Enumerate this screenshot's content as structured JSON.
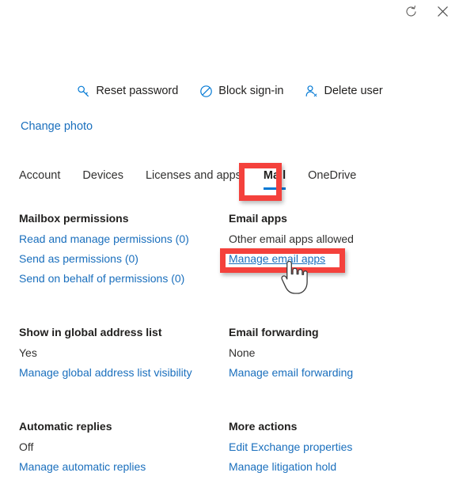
{
  "window": {
    "refresh_label": "Refresh",
    "close_label": "Close"
  },
  "command_bar": {
    "items": [
      {
        "label": "Reset password",
        "icon": "key-icon"
      },
      {
        "label": "Block sign-in",
        "icon": "block-circle-slash-icon"
      },
      {
        "label": "Delete user",
        "icon": "person-remove-icon"
      }
    ]
  },
  "change_photo": {
    "label": "Change photo"
  },
  "tabs": [
    {
      "label": "Account",
      "selected": false
    },
    {
      "label": "Devices",
      "selected": false
    },
    {
      "label": "Licenses and apps",
      "selected": false
    },
    {
      "label": "Mail",
      "selected": true
    },
    {
      "label": "OneDrive",
      "selected": false
    }
  ],
  "sections": {
    "mailbox_permissions": {
      "title": "Mailbox permissions",
      "links": [
        "Read and manage permissions (0)",
        "Send as permissions (0)",
        "Send on behalf of permissions (0)"
      ]
    },
    "email_apps": {
      "title": "Email apps",
      "value": "Other email apps allowed",
      "link": "Manage email apps"
    },
    "global_address_list": {
      "title": "Show in global address list",
      "value": "Yes",
      "link": "Manage global address list visibility"
    },
    "email_forwarding": {
      "title": "Email forwarding",
      "value": "None",
      "link": "Manage email forwarding"
    },
    "automatic_replies": {
      "title": "Automatic replies",
      "value": "Off",
      "link": "Manage automatic replies"
    },
    "more_actions": {
      "title": "More actions",
      "links": [
        "Edit Exchange properties",
        "Manage litigation hold"
      ]
    }
  },
  "colors": {
    "link": "#1a6fbd",
    "accent": "#0078d4",
    "annotation": "#f4413c",
    "text": "#201f1e"
  }
}
